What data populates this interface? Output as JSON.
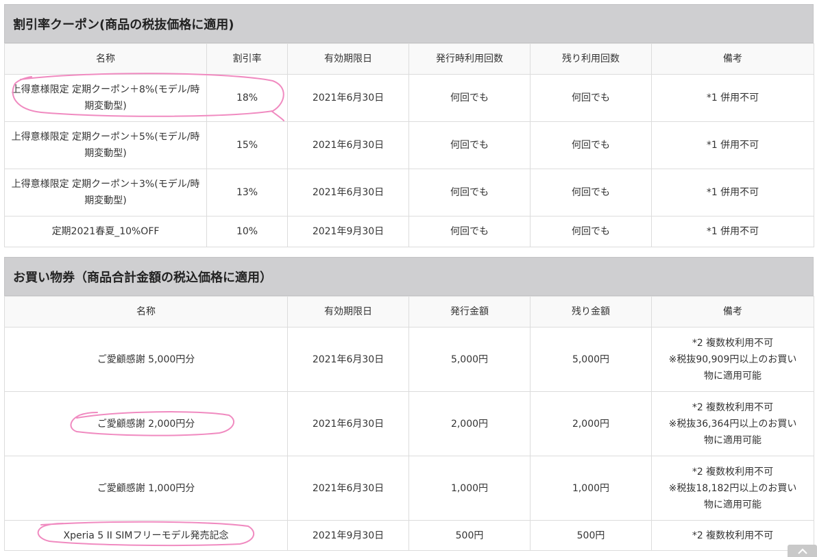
{
  "percent_coupons": {
    "title": "割引率クーポン(商品の税抜価格に適用)",
    "headers": [
      "名称",
      "割引率",
      "有効期限日",
      "発行時利用回数",
      "残り利用回数",
      "備考"
    ],
    "rows": [
      {
        "name": "上得意様限定 定期クーポン＋8%(モデル/時期変動型)",
        "rate": "18%",
        "expiry": "2021年6月30日",
        "issue_uses": "何回でも",
        "remaining_uses": "何回でも",
        "note": "*1 併用不可"
      },
      {
        "name": "上得意様限定 定期クーポン＋5%(モデル/時期変動型)",
        "rate": "15%",
        "expiry": "2021年6月30日",
        "issue_uses": "何回でも",
        "remaining_uses": "何回でも",
        "note": "*1 併用不可"
      },
      {
        "name": "上得意様限定 定期クーポン＋3%(モデル/時期変動型)",
        "rate": "13%",
        "expiry": "2021年6月30日",
        "issue_uses": "何回でも",
        "remaining_uses": "何回でも",
        "note": "*1 併用不可"
      },
      {
        "name": "定期2021春夏_10%OFF",
        "rate": "10%",
        "expiry": "2021年9月30日",
        "issue_uses": "何回でも",
        "remaining_uses": "何回でも",
        "note": "*1 併用不可"
      }
    ]
  },
  "vouchers": {
    "title": "お買い物券（商品合計金額の税込価格に適用）",
    "headers": [
      "名称",
      "有効期限日",
      "発行金額",
      "残り金額",
      "備考"
    ],
    "rows": [
      {
        "name": "ご愛顧感謝 5,000円分",
        "expiry": "2021年6月30日",
        "issued": "5,000円",
        "remaining": "5,000円",
        "note": [
          "*2 複数枚利用不可",
          "※税抜90,909円以上のお買い",
          "物に適用可能"
        ]
      },
      {
        "name": "ご愛顧感謝 2,000円分",
        "expiry": "2021年6月30日",
        "issued": "2,000円",
        "remaining": "2,000円",
        "note": [
          "*2 複数枚利用不可",
          "※税抜36,364円以上のお買い",
          "物に適用可能"
        ]
      },
      {
        "name": "ご愛顧感謝 1,000円分",
        "expiry": "2021年6月30日",
        "issued": "1,000円",
        "remaining": "1,000円",
        "note": [
          "*2 複数枚利用不可",
          "※税抜18,182円以上のお買い",
          "物に適用可能"
        ]
      },
      {
        "name": "Xperia 5 II SIMフリーモデル発売記念",
        "expiry": "2021年9月30日",
        "issued": "500円",
        "remaining": "500円",
        "note": [
          "*2 複数枚利用不可"
        ]
      }
    ]
  },
  "colors": {
    "section_header_bg": "#cfcfd1",
    "table_header_bg": "#f9f9f9",
    "highlight_marker": "#f08ac0"
  },
  "icons": {
    "scroll_top": "chevron-up-icon"
  }
}
